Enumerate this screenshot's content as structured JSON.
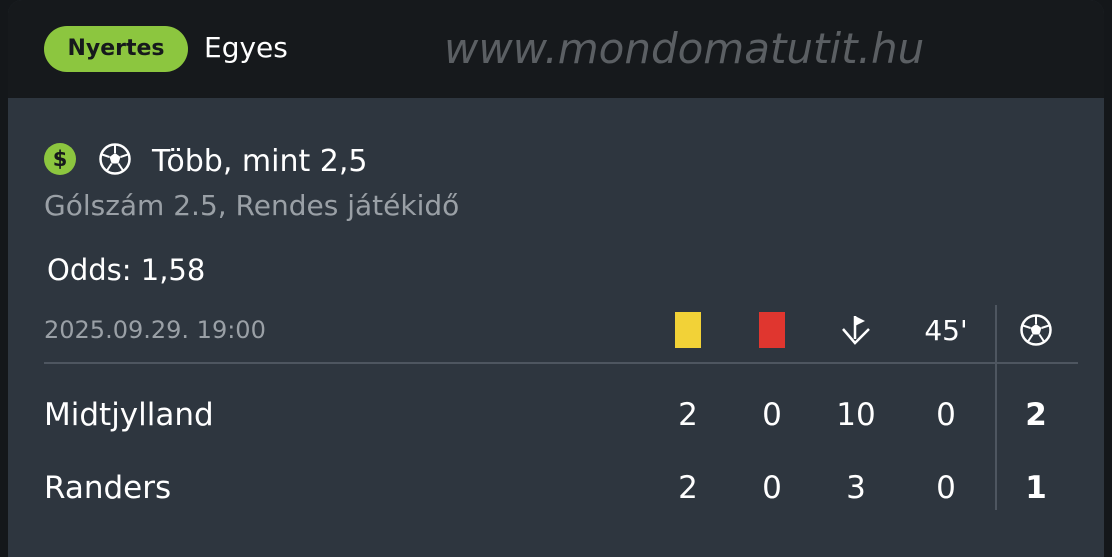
{
  "header": {
    "status_badge": "Nyertes",
    "bet_type": "Egyes",
    "watermark": "www.mondomatutit.hu"
  },
  "bet": {
    "selection": "Több, mint 2,5",
    "market": "Gólszám 2.5, Rendes játékidő",
    "odds_text": "Odds: 1,58"
  },
  "match": {
    "datetime": "2025.09.29.  19:00",
    "columns": {
      "halftime_label": "45'"
    },
    "teams": [
      {
        "name": "Midtjylland",
        "yellow": "2",
        "red": "0",
        "corners": "10",
        "halftime": "0",
        "goals": "2"
      },
      {
        "name": "Randers",
        "yellow": "2",
        "red": "0",
        "corners": "3",
        "halftime": "0",
        "goals": "1"
      }
    ]
  },
  "icons": {
    "dollar": "$",
    "selection_icon": "soccer-ball-icon",
    "yellow_card": "yellow-card-icon",
    "red_card": "red-card-icon",
    "corner": "corner-flag-icon",
    "goals": "soccer-ball-icon"
  },
  "colors": {
    "accent_green": "#8cc63f",
    "yellow_card": "#f2d237",
    "red_card": "#e0362f",
    "card_bg": "#2e363f",
    "header_bg": "#16191c"
  }
}
